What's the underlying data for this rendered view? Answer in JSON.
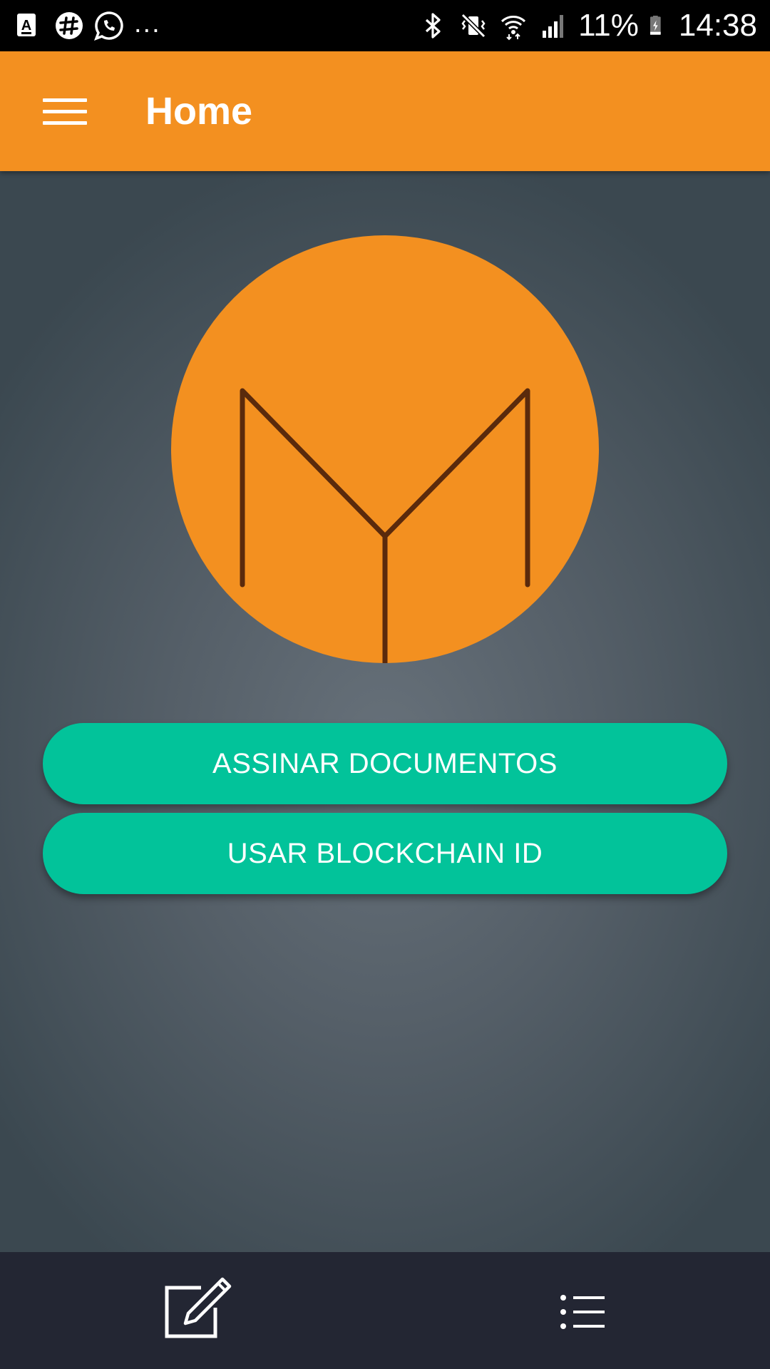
{
  "status_bar": {
    "left_icons": [
      "text-a-icon",
      "slack-icon",
      "whatsapp-icon"
    ],
    "overflow": "...",
    "right_icons": [
      "bluetooth-icon",
      "vibrate-mute-icon",
      "wifi-icon",
      "signal-icon",
      "battery-icon"
    ],
    "battery_percent": "11%",
    "time": "14:38"
  },
  "app_bar": {
    "title": "Home",
    "menu_icon": "hamburger-menu-icon",
    "color": "#f39020"
  },
  "main": {
    "logo_icon": "my-logo",
    "buttons": {
      "sign_documents": "ASSINAR DOCUMENTOS",
      "blockchain_id": "USAR BLOCKCHAIN ID"
    },
    "button_color": "#02c39a"
  },
  "bottom_nav": {
    "items": [
      {
        "icon": "edit-square-icon"
      },
      {
        "icon": "list-icon"
      }
    ]
  }
}
